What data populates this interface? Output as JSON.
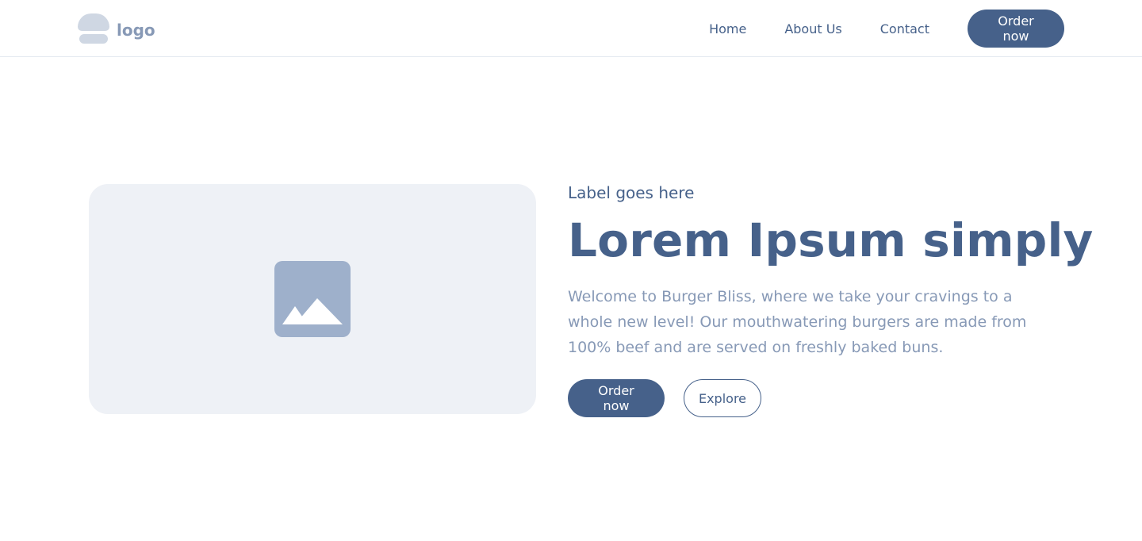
{
  "header": {
    "logo_text": "logo",
    "nav": [
      {
        "label": "Home"
      },
      {
        "label": "About Us"
      },
      {
        "label": "Contact"
      }
    ],
    "cta_label": "Order now"
  },
  "hero": {
    "image_icon": "image-placeholder-icon",
    "label": "Label goes here",
    "title": "Lorem Ipsum simply",
    "description": "Welcome to Burger Bliss, where we take your cravings to a whole new level! Our mouthwatering burgers are made from 100% beef and are served on freshly baked buns.",
    "primary_button": "Order now",
    "secondary_button": "Explore"
  },
  "colors": {
    "primary": "#46618a",
    "muted_text": "#8799b6",
    "image_bg": "#eef1f6",
    "icon_fill": "#9eb0cb",
    "logo_mark": "#cfd7e3"
  }
}
